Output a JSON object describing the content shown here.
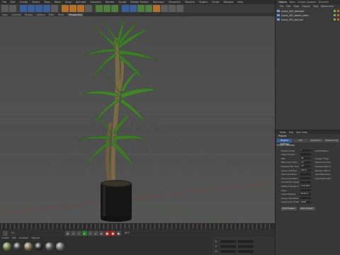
{
  "menubar": [
    "File",
    "Edit",
    "Create",
    "Select",
    "Tools",
    "Mesh",
    "Snap",
    "Animate",
    "Simulate",
    "Render",
    "Sculpt",
    "Motion Tracker",
    "MoGraph",
    "Character",
    "Pipeline",
    "Plugins",
    "Script",
    "Window",
    "Help"
  ],
  "viewport": {
    "menu": [
      "View",
      "Cameras",
      "Display",
      "Options",
      "Filter",
      "Panel"
    ],
    "active_label": "Perspective"
  },
  "toolbar_icons": [
    "undo-icon",
    "redo-icon",
    "selection-icon",
    "move-icon",
    "scale-icon",
    "rotate-icon",
    "recent-icon",
    "x-axis-icon",
    "y-axis-icon",
    "z-axis-icon",
    "coordinate-icon",
    "render-region-icon",
    "render-view-icon",
    "render-settings-icon",
    "cube-icon",
    "pen-icon",
    "subdivision-icon",
    "array-icon",
    "deformer-icon",
    "floor-icon",
    "camera-icon",
    "light-icon"
  ],
  "object_manager": {
    "tabs": [
      "Objects",
      "Takes",
      "Content Browser",
      "Structure"
    ],
    "active_tab": "Objects",
    "menu": [
      "File",
      "Edit",
      "View",
      "Objects",
      "Tags",
      "Bookmarks"
    ],
    "rows": [
      "yucca_002_blackpot",
      "yucca_002_leaves_stem",
      "yucca_002_pot_soil"
    ]
  },
  "attribute_manager": {
    "menu": [
      "Mode",
      "Edit",
      "User Data"
    ],
    "title": "Project",
    "tabs": [
      "Project Settings",
      "Info",
      "Dynamics",
      "Referencing"
    ],
    "active_tab": "Project Settings",
    "section": "Project Settings",
    "rows": [
      {
        "label": "Project Scale",
        "value": "1",
        "label2": "Centimeters"
      },
      {
        "label": "Scale Project...",
        "value": "",
        "label2": ""
      },
      {
        "label": "FPS",
        "value": "30",
        "label2": "Project Time"
      },
      {
        "label": "Minimum Time",
        "value": "0 F",
        "label2": "Maximum Time"
      },
      {
        "label": "Preview Min Time",
        "value": "0 F",
        "label2": "Preview Max Time"
      },
      {
        "label": "Level of Detail",
        "value": "100 %",
        "label2": "Render LOD in Editor"
      },
      {
        "label": "Use Animation",
        "value": "",
        "label2": "Use Expression"
      },
      {
        "label": "Use Generators",
        "value": "",
        "label2": "Use Deformers"
      },
      {
        "label": "Use Motion System",
        "value": "",
        "label2": ""
      },
      {
        "label": "Default Object Color",
        "value": "Gray-Blue",
        "label2": ""
      },
      {
        "label": "Color",
        "value": "",
        "label2": ""
      },
      {
        "label": "View Clipping",
        "value": "Medium",
        "label2": ""
      },
      {
        "label": "Linear Workflow",
        "value": "",
        "label2": ""
      },
      {
        "label": "Input Color Profile",
        "value": "sRGB",
        "label2": ""
      }
    ],
    "buttons": [
      "Load Preset...",
      "Save Preset..."
    ]
  },
  "materials": {
    "menu": [
      "Create",
      "Edit",
      "Function",
      "Texture"
    ],
    "balls": [
      "#6c7a3a",
      "#3e3e3e",
      "#7a6a4a",
      "#2a2a2a",
      "#555555",
      "#6b6b6b"
    ]
  },
  "coords": {
    "rows": [
      "X",
      "Y",
      "Z"
    ]
  },
  "timeline": {
    "current_frame": "0 F",
    "end_frame": "90 F"
  }
}
